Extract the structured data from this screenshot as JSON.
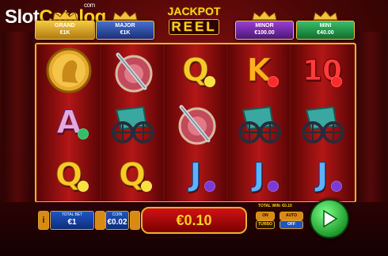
{
  "watermark": {
    "brand": "Slot",
    "brand_accent": "Catalog",
    "suffix": "com"
  },
  "game_title": {
    "line1": "JACKPOT",
    "line2": "REEL"
  },
  "jackpots": [
    {
      "name": "GRAND",
      "value": "€1K"
    },
    {
      "name": "MAJOR",
      "value": "€1K"
    },
    {
      "name": "MINOR",
      "value": "€100.00"
    },
    {
      "name": "MINI",
      "value": "€40.00"
    }
  ],
  "reels": [
    [
      "gold-coin",
      "A",
      "Q"
    ],
    [
      "sword-shield",
      "chariot",
      "Q"
    ],
    [
      "Q",
      "sword-shield",
      "J"
    ],
    [
      "K",
      "chariot",
      "J"
    ],
    [
      "10",
      "chariot",
      "J"
    ]
  ],
  "controls": {
    "info_label": "i",
    "total_bet_label": "TOTAL BET",
    "total_bet_value": "€1",
    "coin_label": "COIN",
    "coin_value": "€0.02",
    "win_display": "€0.10",
    "total_win_text": "TOTAL WIN: €0.10",
    "on_label": "ON",
    "turbo_label": "TURBO",
    "auto_label": "AUTO",
    "off_label": "OFF"
  },
  "colors": {
    "gold": "#ffd21c",
    "spin_green": "#1e9a2a",
    "background_red": "#8a1010"
  }
}
